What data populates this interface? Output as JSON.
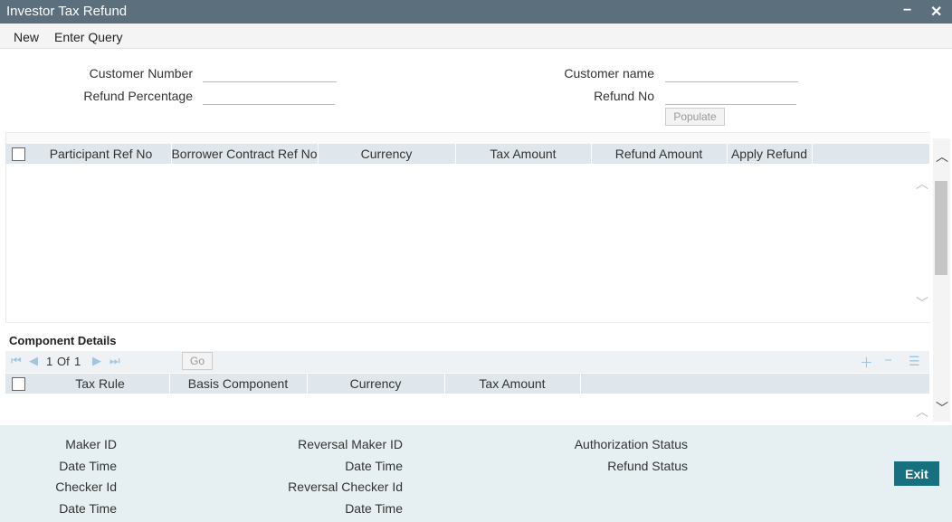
{
  "window": {
    "title": "Investor Tax Refund",
    "minimize": "−",
    "close": "✕"
  },
  "menu": {
    "new": "New",
    "enter_query": "Enter Query"
  },
  "form": {
    "customer_number_label": "Customer Number",
    "customer_number_value": "",
    "refund_percentage_label": "Refund Percentage",
    "refund_percentage_value": "",
    "customer_name_label": "Customer name",
    "customer_name_value": "",
    "refund_no_label": "Refund No",
    "refund_no_value": "",
    "populate_label": "Populate"
  },
  "main_grid": {
    "columns": [
      "Participant Ref No",
      "Borrower Contract Ref No",
      "Currency",
      "Tax Amount",
      "Refund Amount",
      "Apply Refund"
    ]
  },
  "component": {
    "title": "Component Details",
    "pager": {
      "page": "1",
      "of_label": "Of",
      "total": "1",
      "go_label": "Go"
    },
    "columns": [
      "Tax Rule",
      "Basis Component",
      "Currency",
      "Tax Amount"
    ]
  },
  "audit": {
    "maker_id": "Maker ID",
    "date_time_1": "Date Time",
    "checker_id": "Checker Id",
    "date_time_2": "Date Time",
    "reversal_maker_id": "Reversal Maker ID",
    "date_time_3": "Date Time",
    "reversal_checker_id": "Reversal Checker Id",
    "date_time_4": "Date Time",
    "authorization_status": "Authorization Status",
    "refund_status": "Refund Status"
  },
  "exit_label": "Exit",
  "colors": {
    "titlebar": "#5b6f7d",
    "header": "#dfe7ec",
    "footer": "#e6f0f3",
    "exit": "#16707f",
    "pager_icon": "#9fc6e0"
  },
  "icons": {
    "first": "first-page-icon",
    "prev": "prev-page-icon",
    "next": "next-page-icon",
    "last": "last-page-icon",
    "add": "plus-icon",
    "remove": "minus-icon",
    "list": "list-icon"
  }
}
